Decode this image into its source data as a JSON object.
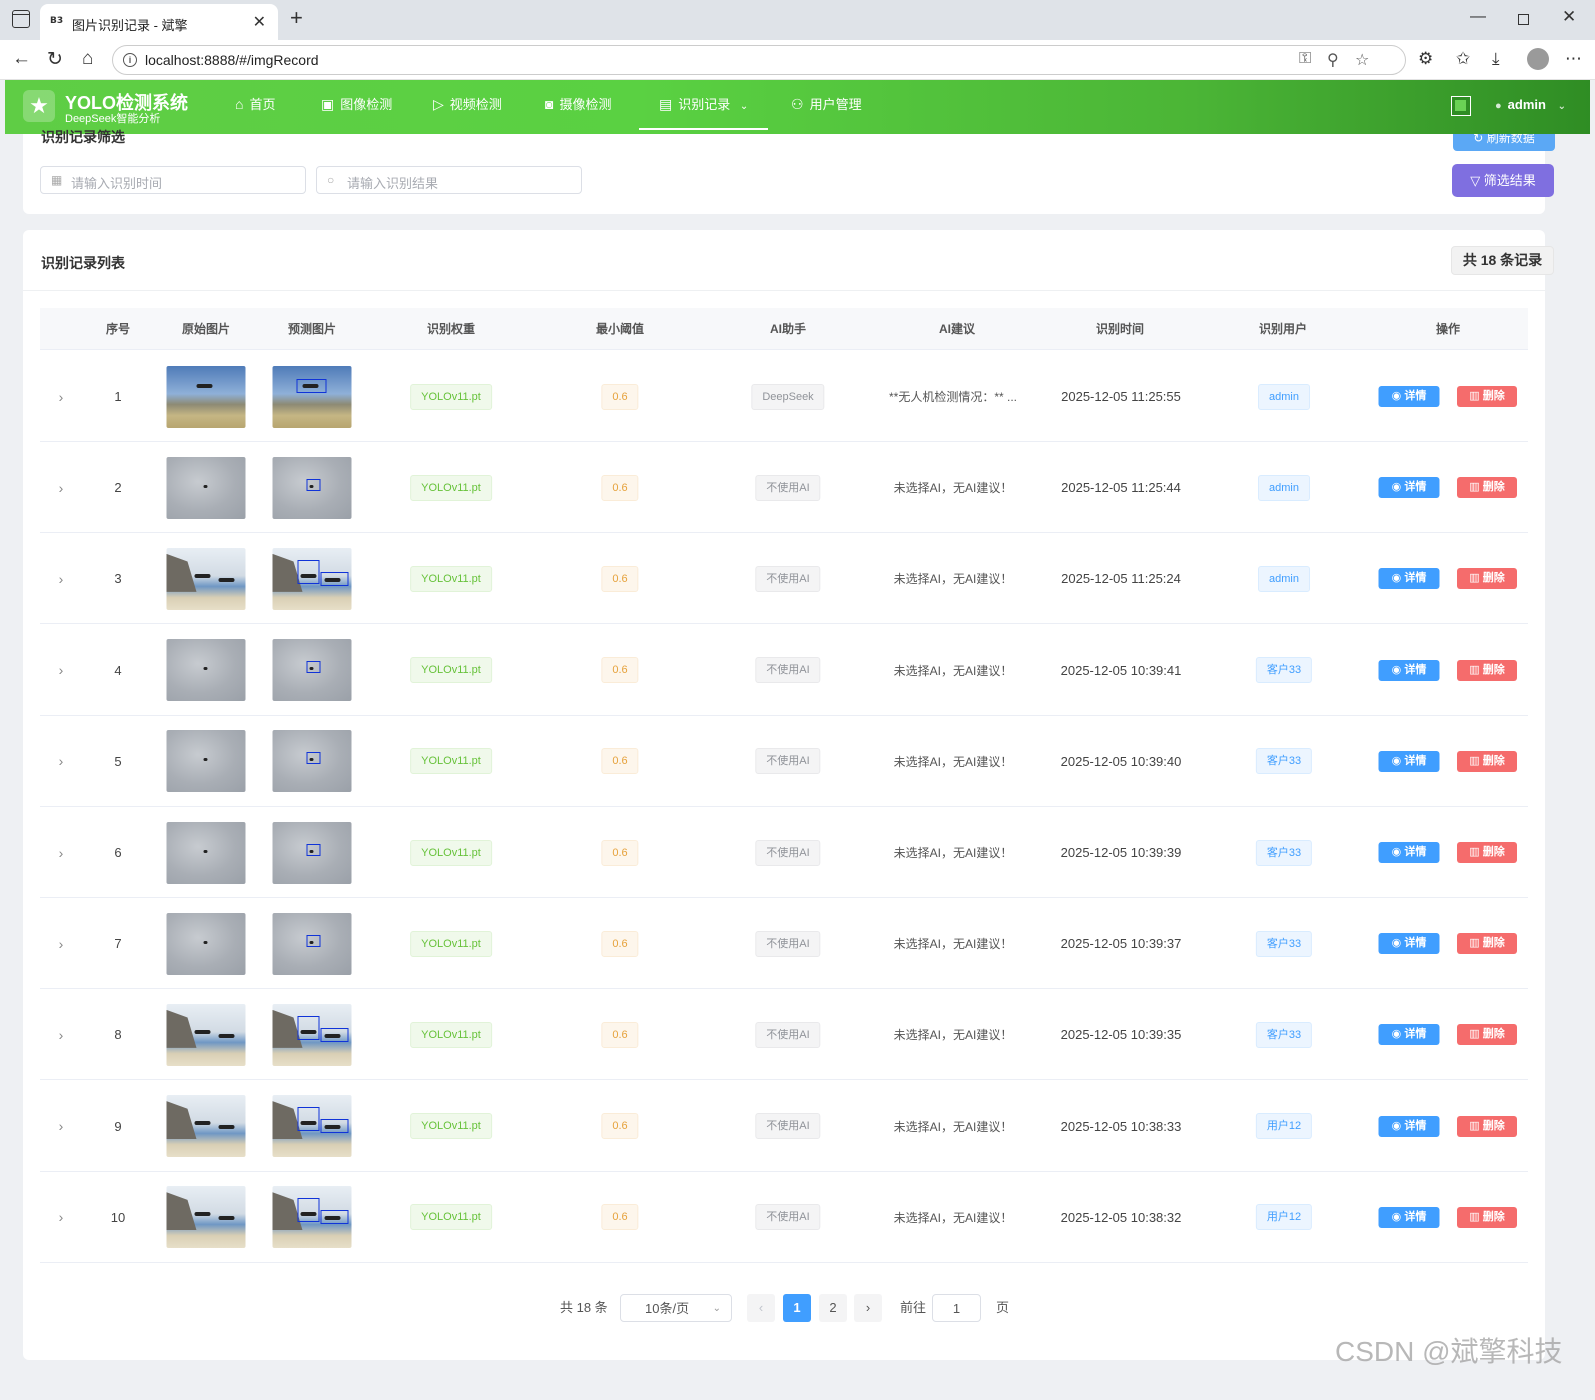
{
  "browser": {
    "favicon": "B3",
    "tab_title": "图片识别记录 - 斌擎",
    "url": "localhost:8888/#/imgRecord",
    "icons": [
      "back-icon",
      "reload-icon",
      "home-icon",
      "key-icon",
      "zoom-icon",
      "star-icon",
      "extensions-icon",
      "favorites-icon",
      "download-icon",
      "more-icon"
    ]
  },
  "header": {
    "logo_title": "YOLO检测系统",
    "logo_subtitle": "DeepSeek智能分析",
    "nav": [
      {
        "label": "首页",
        "icon": "home-icon"
      },
      {
        "label": "图像检测",
        "icon": "image-icon"
      },
      {
        "label": "视频检测",
        "icon": "play-icon"
      },
      {
        "label": "摄像检测",
        "icon": "camera-icon"
      },
      {
        "label": "识别记录",
        "icon": "document-icon"
      },
      {
        "label": "用户管理",
        "icon": "user-icon"
      }
    ],
    "username": "admin",
    "accent_color": "#5ad142"
  },
  "filter": {
    "title": "识别记录筛选",
    "refresh_label": "刷新数据",
    "time_placeholder": "请输入识别时间",
    "result_placeholder": "请输入识别结果",
    "filter_label": "筛选结果"
  },
  "list": {
    "title": "识别记录列表",
    "total_label": "共 18 条记录",
    "columns": [
      "序号",
      "原始图片",
      "预测图片",
      "识别权重",
      "最小阈值",
      "AI助手",
      "AI建议",
      "识别时间",
      "识别用户",
      "操作"
    ],
    "detail_label": "详情",
    "delete_label": "删除",
    "rows": [
      {
        "seq": "1",
        "image": "mountain",
        "weight": "YOLOv11.pt",
        "threshold": "0.6",
        "ai": "DeepSeek",
        "advice": "**无人机检测情况：** ...",
        "time": "2025-12-05 11:25:55",
        "user": "admin"
      },
      {
        "seq": "2",
        "image": "sky",
        "weight": "YOLOv11.pt",
        "threshold": "0.6",
        "ai": "不使用AI",
        "advice": "未选择AI，无AI建议！",
        "time": "2025-12-05 11:25:44",
        "user": "admin"
      },
      {
        "seq": "3",
        "image": "coast",
        "weight": "YOLOv11.pt",
        "threshold": "0.6",
        "ai": "不使用AI",
        "advice": "未选择AI，无AI建议！",
        "time": "2025-12-05 11:25:24",
        "user": "admin"
      },
      {
        "seq": "4",
        "image": "sky",
        "weight": "YOLOv11.pt",
        "threshold": "0.6",
        "ai": "不使用AI",
        "advice": "未选择AI，无AI建议！",
        "time": "2025-12-05 10:39:41",
        "user": "客户33"
      },
      {
        "seq": "5",
        "image": "sky",
        "weight": "YOLOv11.pt",
        "threshold": "0.6",
        "ai": "不使用AI",
        "advice": "未选择AI，无AI建议！",
        "time": "2025-12-05 10:39:40",
        "user": "客户33"
      },
      {
        "seq": "6",
        "image": "sky",
        "weight": "YOLOv11.pt",
        "threshold": "0.6",
        "ai": "不使用AI",
        "advice": "未选择AI，无AI建议！",
        "time": "2025-12-05 10:39:39",
        "user": "客户33"
      },
      {
        "seq": "7",
        "image": "sky",
        "weight": "YOLOv11.pt",
        "threshold": "0.6",
        "ai": "不使用AI",
        "advice": "未选择AI，无AI建议！",
        "time": "2025-12-05 10:39:37",
        "user": "客户33"
      },
      {
        "seq": "8",
        "image": "coast",
        "weight": "YOLOv11.pt",
        "threshold": "0.6",
        "ai": "不使用AI",
        "advice": "未选择AI，无AI建议！",
        "time": "2025-12-05 10:39:35",
        "user": "客户33"
      },
      {
        "seq": "9",
        "image": "coast",
        "weight": "YOLOv11.pt",
        "threshold": "0.6",
        "ai": "不使用AI",
        "advice": "未选择AI，无AI建议！",
        "time": "2025-12-05 10:38:33",
        "user": "用户12"
      },
      {
        "seq": "10",
        "image": "coast",
        "weight": "YOLOv11.pt",
        "threshold": "0.6",
        "ai": "不使用AI",
        "advice": "未选择AI，无AI建议！",
        "time": "2025-12-05 10:38:32",
        "user": "用户12"
      }
    ]
  },
  "pagination": {
    "total": "共 18 条",
    "page_size": "10条/页",
    "pages": [
      "1",
      "2"
    ],
    "current": "1",
    "goto_label": "前往",
    "goto_value": "1",
    "page_unit": "页"
  },
  "watermark": "CSDN @斌擎科技"
}
